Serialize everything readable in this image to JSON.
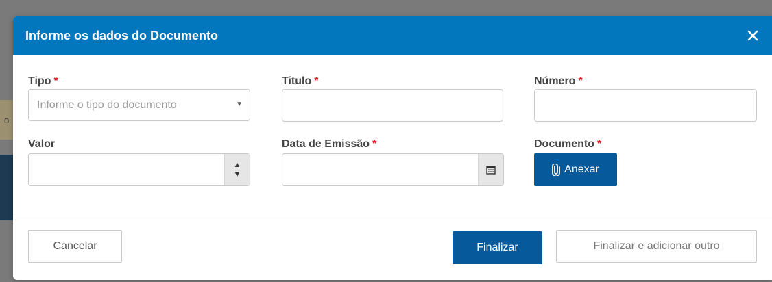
{
  "background": {
    "partial_text": "o"
  },
  "modal": {
    "title": "Informe os dados do Documento",
    "close_icon": "close-icon"
  },
  "fields": {
    "tipo": {
      "label": "Tipo",
      "required": "*",
      "placeholder": "Informe o tipo do documento"
    },
    "titulo": {
      "label": "Titulo",
      "required": "*",
      "value": ""
    },
    "numero": {
      "label": "Número",
      "required": "*",
      "value": ""
    },
    "valor": {
      "label": "Valor",
      "value": ""
    },
    "data_emissao": {
      "label": "Data de Emissão",
      "required": "*",
      "value": ""
    },
    "documento": {
      "label": "Documento",
      "required": "*",
      "attach_label": "Anexar"
    }
  },
  "footer": {
    "cancel_label": "Cancelar",
    "finalize_label": "Finalizar",
    "finalize_add_label": "Finalizar e adicionar outro"
  },
  "colors": {
    "header": "#0277bd",
    "primary_button": "#06599a",
    "required_marker": "#e02424"
  }
}
